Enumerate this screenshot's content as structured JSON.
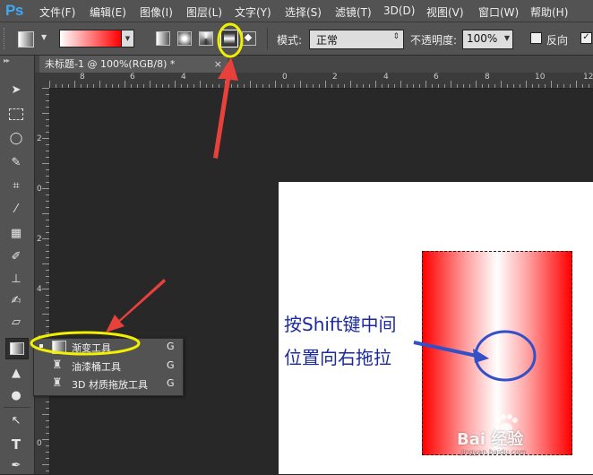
{
  "app": {
    "logo": "Ps"
  },
  "menu": [
    {
      "label": "文件(F)"
    },
    {
      "label": "编辑(E)"
    },
    {
      "label": "图像(I)"
    },
    {
      "label": "图层(L)"
    },
    {
      "label": "文字(Y)"
    },
    {
      "label": "选择(S)"
    },
    {
      "label": "滤镜(T)"
    },
    {
      "label": "3D(D)"
    },
    {
      "label": "视图(V)"
    },
    {
      "label": "窗口(W)"
    },
    {
      "label": "帮助(H)"
    }
  ],
  "options": {
    "mode_label": "模式:",
    "mode_value": "正常",
    "opacity_label": "不透明度:",
    "opacity_value": "100%",
    "reverse_label": "反向"
  },
  "document": {
    "tab_title": "未标题-1 @ 100%(RGB/8) *",
    "tab_close": "×"
  },
  "ruler": {
    "h_labels": [
      "8",
      "6",
      "4",
      "2",
      "0",
      "2",
      "4",
      "6",
      "8",
      "10",
      "12"
    ],
    "v_labels": [
      "2",
      "0",
      "2",
      "4",
      "6",
      "8",
      "0"
    ]
  },
  "flyout": {
    "items": [
      {
        "label": "渐变工具",
        "key": "G",
        "active": true
      },
      {
        "label": "油漆桶工具",
        "key": "G",
        "active": false
      },
      {
        "label": "3D 材质拖放工具",
        "key": "G",
        "active": false
      }
    ]
  },
  "annotation": {
    "line1": "按Shift键中间",
    "line2": "位置向右拖拉"
  },
  "watermark": {
    "text": "Bai 经验",
    "sub": "jingyan.baidu.com"
  },
  "colors": {
    "accent": "#3fa9f5",
    "highlight": "#f0f000",
    "arrow": "#e8413c",
    "annot": "#1c2a9c",
    "annot_circle": "#3350c8"
  }
}
